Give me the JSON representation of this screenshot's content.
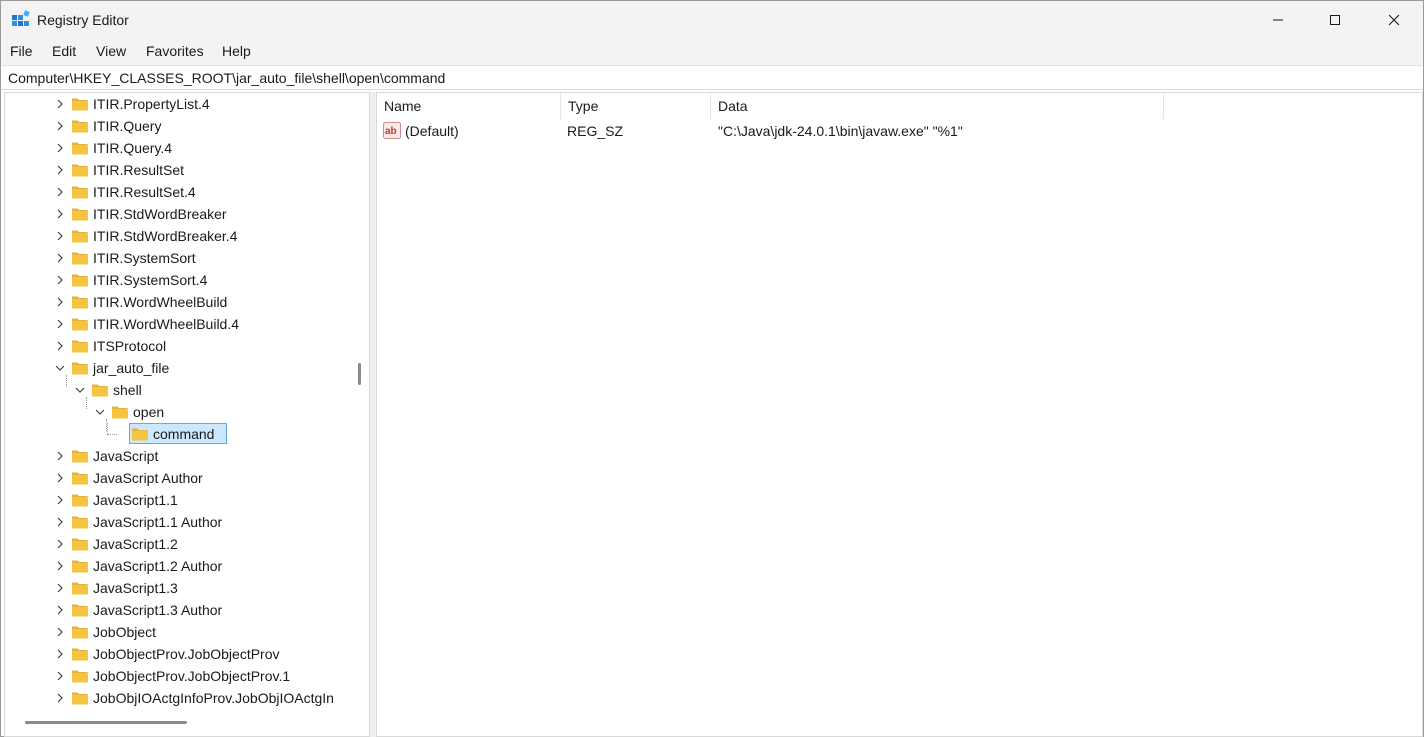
{
  "window": {
    "title": "Registry Editor"
  },
  "menu": [
    "File",
    "Edit",
    "View",
    "Favorites",
    "Help"
  ],
  "address": "Computer\\HKEY_CLASSES_ROOT\\jar_auto_file\\shell\\open\\command",
  "tree": [
    {
      "label": "ITIR.PropertyList.4",
      "level": 0,
      "state": "collapsed"
    },
    {
      "label": "ITIR.Query",
      "level": 0,
      "state": "collapsed"
    },
    {
      "label": "ITIR.Query.4",
      "level": 0,
      "state": "collapsed"
    },
    {
      "label": "ITIR.ResultSet",
      "level": 0,
      "state": "collapsed"
    },
    {
      "label": "ITIR.ResultSet.4",
      "level": 0,
      "state": "collapsed"
    },
    {
      "label": "ITIR.StdWordBreaker",
      "level": 0,
      "state": "collapsed"
    },
    {
      "label": "ITIR.StdWordBreaker.4",
      "level": 0,
      "state": "collapsed"
    },
    {
      "label": "ITIR.SystemSort",
      "level": 0,
      "state": "collapsed"
    },
    {
      "label": "ITIR.SystemSort.4",
      "level": 0,
      "state": "collapsed"
    },
    {
      "label": "ITIR.WordWheelBuild",
      "level": 0,
      "state": "collapsed"
    },
    {
      "label": "ITIR.WordWheelBuild.4",
      "level": 0,
      "state": "collapsed"
    },
    {
      "label": "ITSProtocol",
      "level": 0,
      "state": "collapsed"
    },
    {
      "label": "jar_auto_file",
      "level": 0,
      "state": "expanded"
    },
    {
      "label": "shell",
      "level": 1,
      "state": "expanded"
    },
    {
      "label": "open",
      "level": 2,
      "state": "expanded"
    },
    {
      "label": "command",
      "level": 3,
      "state": "leaf",
      "selected": true
    },
    {
      "label": "JavaScript",
      "level": 0,
      "state": "collapsed"
    },
    {
      "label": "JavaScript Author",
      "level": 0,
      "state": "collapsed"
    },
    {
      "label": "JavaScript1.1",
      "level": 0,
      "state": "collapsed"
    },
    {
      "label": "JavaScript1.1 Author",
      "level": 0,
      "state": "collapsed"
    },
    {
      "label": "JavaScript1.2",
      "level": 0,
      "state": "collapsed"
    },
    {
      "label": "JavaScript1.2 Author",
      "level": 0,
      "state": "collapsed"
    },
    {
      "label": "JavaScript1.3",
      "level": 0,
      "state": "collapsed"
    },
    {
      "label": "JavaScript1.3 Author",
      "level": 0,
      "state": "collapsed"
    },
    {
      "label": "JobObject",
      "level": 0,
      "state": "collapsed"
    },
    {
      "label": "JobObjectProv.JobObjectProv",
      "level": 0,
      "state": "collapsed"
    },
    {
      "label": "JobObjectProv.JobObjectProv.1",
      "level": 0,
      "state": "collapsed"
    },
    {
      "label": "JobObjIOActgInfoProv.JobObjIOActgIn",
      "level": 0,
      "state": "collapsed"
    }
  ],
  "list": {
    "columns": [
      "Name",
      "Type",
      "Data"
    ],
    "rows": [
      {
        "icon": "string-value-icon",
        "name": "(Default)",
        "type": "REG_SZ",
        "data": "\"C:\\Java\\jdk-24.0.1\\bin\\javaw.exe\" \"%1\""
      }
    ]
  },
  "colors": {
    "folder": "#f5c542",
    "selection": "#cce8ff",
    "selection_border": "#66a7e8",
    "string_icon": "#c0392b"
  }
}
